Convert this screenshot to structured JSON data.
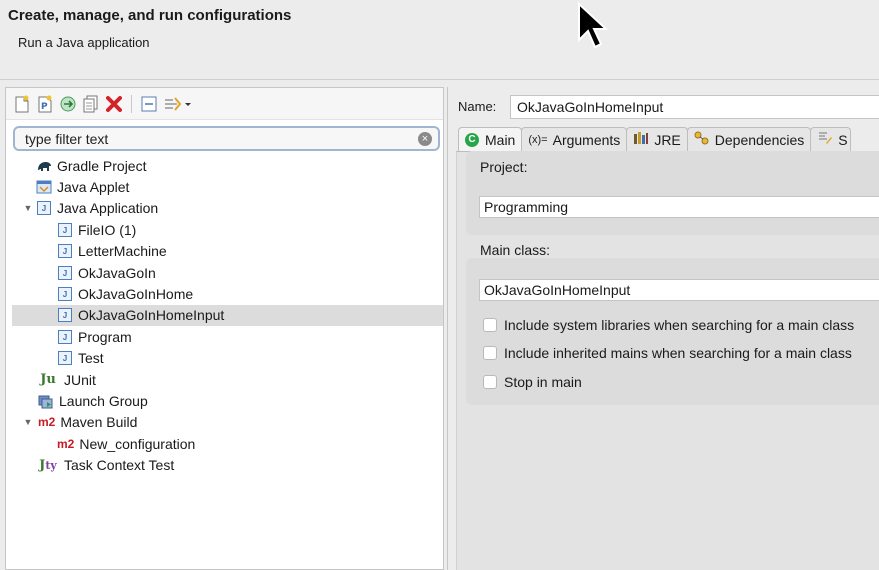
{
  "header": {
    "title": "Create, manage, and run configurations",
    "subtitle": "Run a Java application"
  },
  "toolbar": {
    "icons": [
      "new-config-icon",
      "new-prototype-icon",
      "export-icon",
      "duplicate-icon",
      "delete-icon",
      "collapse-all-icon",
      "filter-icon"
    ]
  },
  "filter": {
    "placeholder": "type filter text"
  },
  "tree": {
    "gradle": "Gradle Project",
    "applet": "Java Applet",
    "java_app": "Java Application",
    "children": [
      "FileIO (1)",
      "LetterMachine",
      "OkJavaGoIn",
      "OkJavaGoInHome",
      "OkJavaGoInHomeInput",
      "Program",
      "Test"
    ],
    "junit": "JUnit",
    "launch_group": "Launch Group",
    "maven": "Maven Build",
    "maven_child": "New_configuration",
    "task_context": "Task Context Test",
    "m2_label": "m2",
    "junit_glyph": "Ju"
  },
  "form": {
    "name_label": "Name:",
    "name_value": "OkJavaGoInHomeInput",
    "tabs": {
      "main": "Main",
      "arguments_prefix": "(x)=",
      "arguments": "Arguments",
      "jre": "JRE",
      "dependencies": "Dependencies",
      "source_partial": "S"
    },
    "project_label": "Project:",
    "project_value": "Programming",
    "main_class_label": "Main class:",
    "main_class_value": "OkJavaGoInHomeInput",
    "checks": [
      "Include system libraries when searching for a main class",
      "Include inherited mains when searching for a main class",
      "Stop in main"
    ]
  }
}
